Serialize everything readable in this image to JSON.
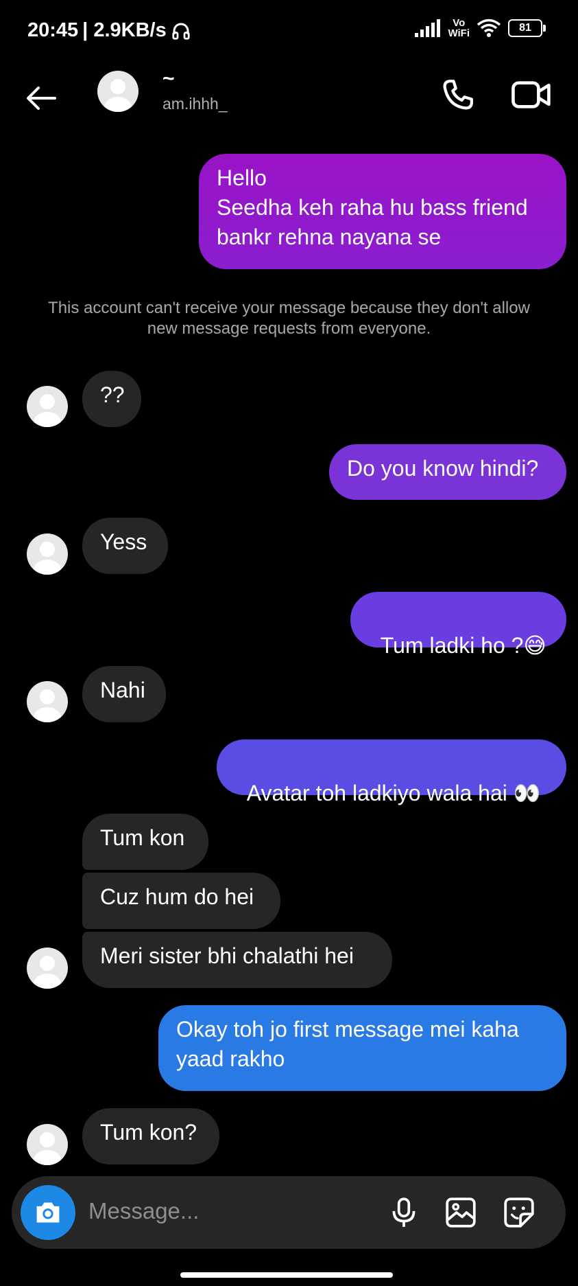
{
  "status_bar": {
    "time": "20:45",
    "speed": "| 2.9KB/s",
    "volte_top": "Vo",
    "volte_bottom": "WiFi",
    "battery": "81"
  },
  "header": {
    "display_name": "~",
    "username": "am.ihhh_",
    "icons": [
      "back-arrow-icon",
      "phone-icon",
      "video-camera-icon"
    ]
  },
  "messages": [
    {
      "side": "out",
      "text": "Hello\nSeedha keh raha hu bass friend\nbankr rehna nayana se",
      "color": "#9a12c6"
    },
    {
      "side": "in",
      "text": "??"
    },
    {
      "side": "out",
      "text": "Do you know hindi?",
      "color": "#7a33d6"
    },
    {
      "side": "in",
      "text": "Yess"
    },
    {
      "side": "out",
      "text": "Tum ladki ho ?",
      "emoji": "😅",
      "color": "#6a3de0"
    },
    {
      "side": "in",
      "text": "Nahi"
    },
    {
      "side": "out",
      "text": "Avatar toh ladkiyo wala hai",
      "emoji": "👀",
      "color": "#5a4de3"
    },
    {
      "side": "in",
      "text": "Tum kon"
    },
    {
      "side": "in",
      "text": "Cuz hum do hei"
    },
    {
      "side": "in",
      "text": "Meri sister bhi chalathi hei"
    },
    {
      "side": "out",
      "text": "Okay toh jo first message mei kaha\nyaad rakho",
      "color": "#2a7ae6"
    },
    {
      "side": "in",
      "text": "Tum kon?"
    }
  ],
  "notice": "This account can't receive your message because they don't allow new message requests from everyone.",
  "composer": {
    "placeholder": "Message...",
    "icons": [
      "camera-icon",
      "microphone-icon",
      "gallery-icon",
      "sticker-icon"
    ]
  },
  "colors": {
    "background": "#000000",
    "incoming_bubble": "#262626",
    "camera_button": "#1e88e5"
  }
}
